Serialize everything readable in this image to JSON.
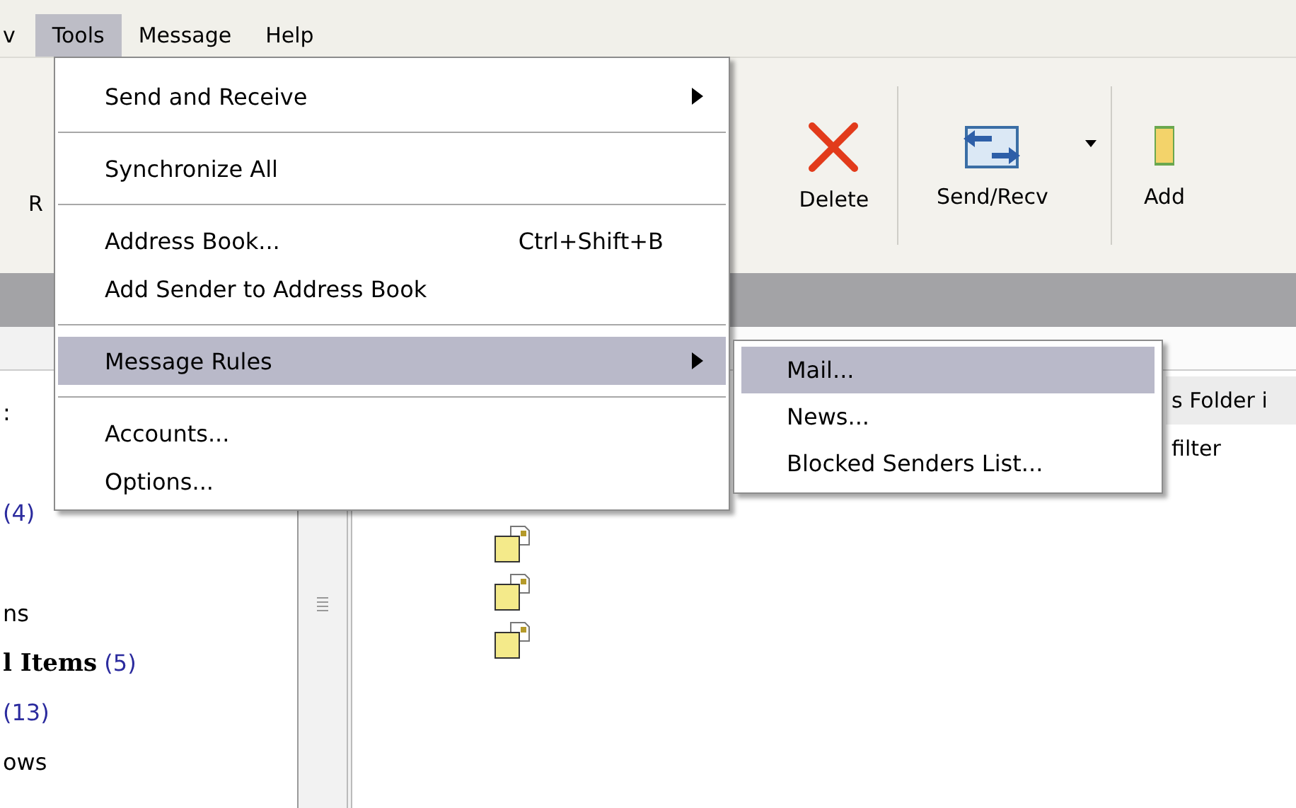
{
  "menubar": [
    {
      "label": "v",
      "selected": false
    },
    {
      "label": "Tools",
      "selected": true
    },
    {
      "label": "Message",
      "selected": false
    },
    {
      "label": "Help",
      "selected": false
    }
  ],
  "toolbar": [
    {
      "kind": "partial",
      "label": "R"
    },
    {
      "kind": "delete",
      "label": "Delete"
    },
    {
      "kind": "sendrecv",
      "label": "Send/Recv"
    },
    {
      "kind": "addressbook",
      "label": "Add"
    }
  ],
  "menu": {
    "items": [
      {
        "kind": "item",
        "label": "Send and Receive",
        "submenu": true,
        "selected": false
      },
      {
        "kind": "separator"
      },
      {
        "kind": "item",
        "label": "Synchronize All",
        "submenu": false,
        "selected": false
      },
      {
        "kind": "separator"
      },
      {
        "kind": "item",
        "label": "Address Book...",
        "shortcut": "Ctrl+Shift+B",
        "submenu": false,
        "selected": false
      },
      {
        "kind": "item",
        "label": "Add Sender to Address Book",
        "submenu": false,
        "selected": false
      },
      {
        "kind": "separator"
      },
      {
        "kind": "item",
        "label": "Message Rules",
        "submenu": true,
        "selected": true
      },
      {
        "kind": "separator"
      },
      {
        "kind": "item",
        "label": "Accounts...",
        "submenu": false,
        "selected": false
      },
      {
        "kind": "item",
        "label": "Options...",
        "submenu": false,
        "selected": false
      }
    ]
  },
  "submenu": {
    "items": [
      {
        "label": "Mail...",
        "selected": true
      },
      {
        "label": "News...",
        "selected": false
      },
      {
        "label": "Blocked Senders List...",
        "selected": false
      }
    ]
  },
  "folders": [
    {
      "name": ":",
      "bold": false
    },
    {
      "count": "(4)"
    },
    {
      "name": "ns",
      "bold": false
    },
    {
      "name": "l Items",
      "count": "(5)",
      "bold": true
    },
    {
      "count": "(13)"
    },
    {
      "name": "ows",
      "bold": false
    }
  ],
  "messages": [
    {
      "subject": "s Folder i",
      "selected": true
    },
    {
      "subject": "filter",
      "selected": false
    }
  ]
}
